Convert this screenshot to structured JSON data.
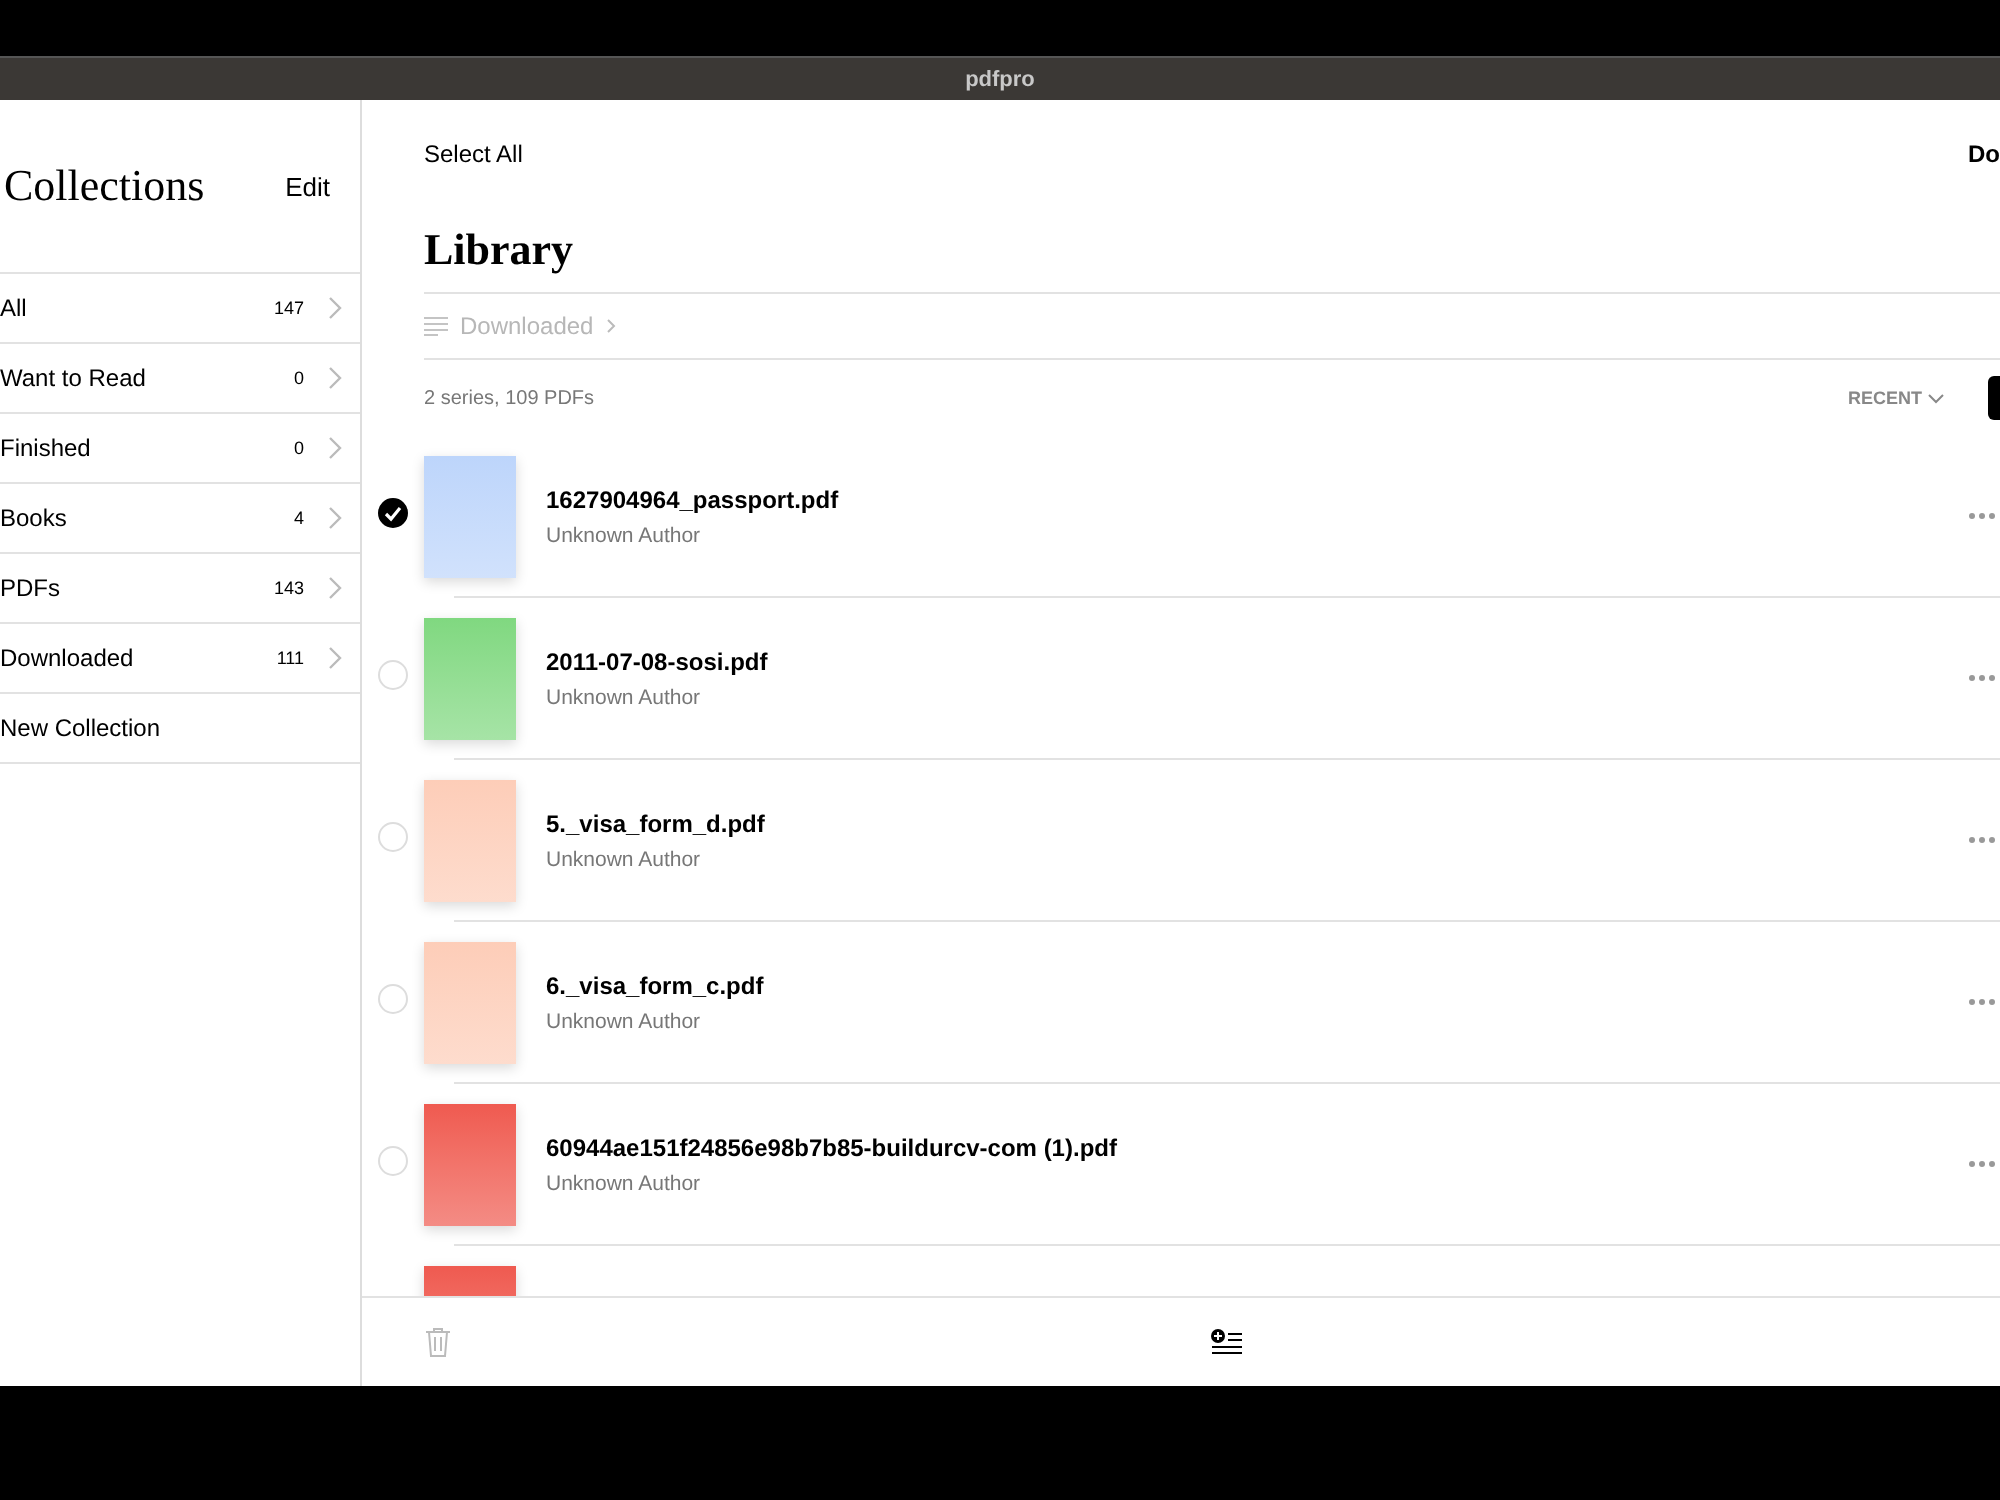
{
  "window": {
    "title": "pdfpro"
  },
  "sidebar": {
    "title": "Collections",
    "edit": "Edit",
    "items": [
      {
        "label": "All",
        "count": "147"
      },
      {
        "label": "Want to Read",
        "count": "0"
      },
      {
        "label": "Finished",
        "count": "0"
      },
      {
        "label": "Books",
        "count": "4"
      },
      {
        "label": "PDFs",
        "count": "143"
      },
      {
        "label": "Downloaded",
        "count": "111"
      }
    ],
    "new_collection": "New Collection"
  },
  "toolbar": {
    "select_all": "Select All",
    "done": "Do"
  },
  "library": {
    "title": "Library",
    "breadcrumb": "Downloaded",
    "summary": "2 series, 109 PDFs",
    "sort": "RECENT"
  },
  "items": [
    {
      "title": "1627904964_passport.pdf",
      "author": "Unknown Author",
      "selected": true,
      "color": "#bdd5fb"
    },
    {
      "title": "2011-07-08-sosi.pdf",
      "author": "Unknown Author",
      "selected": false,
      "color": "#80d880"
    },
    {
      "title": "5._visa_form_d.pdf",
      "author": "Unknown Author",
      "selected": false,
      "color": "#fdcdb8"
    },
    {
      "title": "6._visa_form_c.pdf",
      "author": "Unknown Author",
      "selected": false,
      "color": "#fdcdb8"
    },
    {
      "title": "60944ae151f24856e98b7b85-buildurcv-com (1).pdf",
      "author": "Unknown Author",
      "selected": false,
      "color": "#ef5a50"
    },
    {
      "color": "#ef5a50"
    }
  ]
}
